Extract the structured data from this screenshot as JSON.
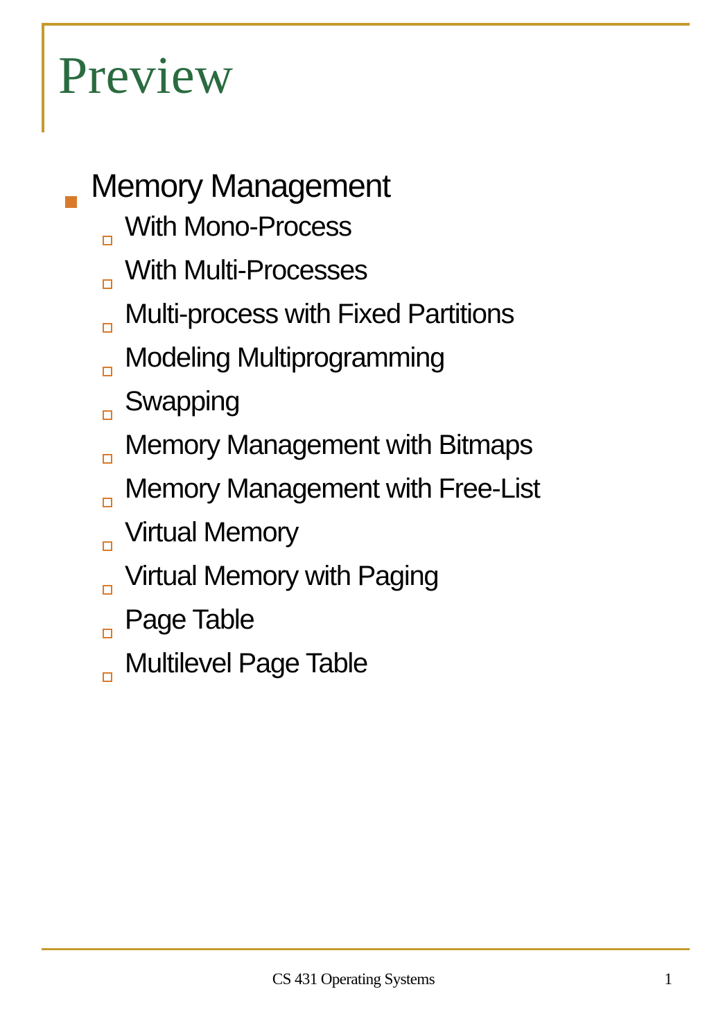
{
  "title": "Preview",
  "content": {
    "heading": "Memory Management",
    "items": [
      "With Mono-Process",
      "With Multi-Processes",
      "Multi-process with Fixed Partitions",
      "Modeling Multiprogramming",
      "Swapping",
      "Memory Management with Bitmaps",
      "Memory Management with Free-List",
      "Virtual Memory",
      "Virtual Memory with Paging",
      "Page Table",
      "Multilevel Page Table"
    ]
  },
  "footer": {
    "center": "CS 431 Operating Systems",
    "page": "1"
  }
}
